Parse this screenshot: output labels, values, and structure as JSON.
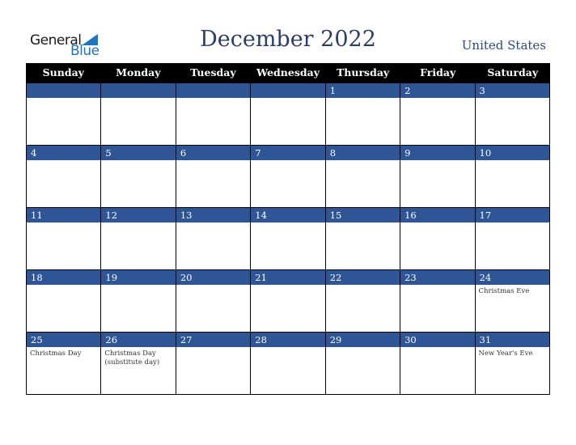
{
  "logo": {
    "line1": "General",
    "line2": "Blue"
  },
  "title": "December 2022",
  "country": "United States",
  "colors": {
    "header_bg": "#000000",
    "day_bar": "#2e5596",
    "title": "#2b3e6b",
    "logo_blue": "#1e75bb"
  },
  "weekdays": [
    "Sunday",
    "Monday",
    "Tuesday",
    "Wednesday",
    "Thursday",
    "Friday",
    "Saturday"
  ],
  "weeks": [
    [
      {
        "day": "",
        "event": ""
      },
      {
        "day": "",
        "event": ""
      },
      {
        "day": "",
        "event": ""
      },
      {
        "day": "",
        "event": ""
      },
      {
        "day": "1",
        "event": ""
      },
      {
        "day": "2",
        "event": ""
      },
      {
        "day": "3",
        "event": ""
      }
    ],
    [
      {
        "day": "4",
        "event": ""
      },
      {
        "day": "5",
        "event": ""
      },
      {
        "day": "6",
        "event": ""
      },
      {
        "day": "7",
        "event": ""
      },
      {
        "day": "8",
        "event": ""
      },
      {
        "day": "9",
        "event": ""
      },
      {
        "day": "10",
        "event": ""
      }
    ],
    [
      {
        "day": "11",
        "event": ""
      },
      {
        "day": "12",
        "event": ""
      },
      {
        "day": "13",
        "event": ""
      },
      {
        "day": "14",
        "event": ""
      },
      {
        "day": "15",
        "event": ""
      },
      {
        "day": "16",
        "event": ""
      },
      {
        "day": "17",
        "event": ""
      }
    ],
    [
      {
        "day": "18",
        "event": ""
      },
      {
        "day": "19",
        "event": ""
      },
      {
        "day": "20",
        "event": ""
      },
      {
        "day": "21",
        "event": ""
      },
      {
        "day": "22",
        "event": ""
      },
      {
        "day": "23",
        "event": ""
      },
      {
        "day": "24",
        "event": "Christmas Eve"
      }
    ],
    [
      {
        "day": "25",
        "event": "Christmas Day"
      },
      {
        "day": "26",
        "event": "Christmas Day (substitute day)"
      },
      {
        "day": "27",
        "event": ""
      },
      {
        "day": "28",
        "event": ""
      },
      {
        "day": "29",
        "event": ""
      },
      {
        "day": "30",
        "event": ""
      },
      {
        "day": "31",
        "event": "New Year's Eve"
      }
    ]
  ]
}
